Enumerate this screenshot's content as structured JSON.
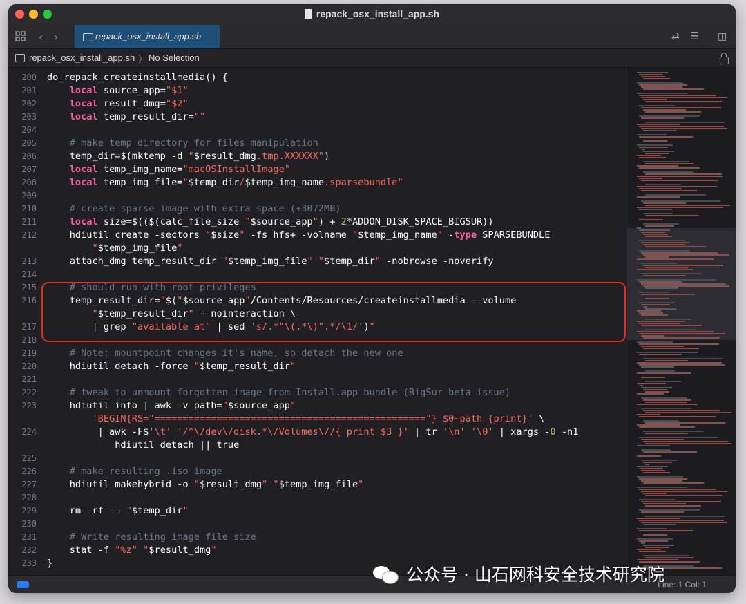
{
  "window": {
    "title": "repack_osx_install_app.sh"
  },
  "tab": {
    "label": "repack_osx_install_app.sh"
  },
  "jumpbar": {
    "file": "repack_osx_install_app.sh",
    "separator": "〉",
    "selection": "No Selection"
  },
  "status": {
    "position": "Line: 1  Col: 1"
  },
  "watermark": {
    "text": "公众号 · 山石网科安全技术研究院"
  },
  "colors": {
    "keyword": "#fc5fa3",
    "string": "#fc6a5d",
    "comment": "#6c7986",
    "number": "#d0bf69",
    "tab_active": "#1f4e79",
    "highlight_box": "#d8302a"
  },
  "icons": [
    "grid-icon",
    "back-chevron-icon",
    "forward-chevron-icon",
    "terminal-file-icon",
    "swap-arrows-icon",
    "lines-icon",
    "sidebar-toggle-icon",
    "lock-icon",
    "wechat-icon"
  ],
  "code_lines": [
    {
      "n": "200",
      "t": [
        [
          "",
          "do_repack_createinstallmedia() {"
        ]
      ]
    },
    {
      "n": "201",
      "t": [
        [
          "",
          "    "
        ],
        [
          "kw",
          "local"
        ],
        [
          "",
          " source_app="
        ],
        [
          "str",
          "\"$1\""
        ]
      ]
    },
    {
      "n": "202",
      "t": [
        [
          "",
          "    "
        ],
        [
          "kw",
          "local"
        ],
        [
          "",
          " result_dmg="
        ],
        [
          "str",
          "\"$2\""
        ]
      ]
    },
    {
      "n": "203",
      "t": [
        [
          "",
          "    "
        ],
        [
          "kw",
          "local"
        ],
        [
          "",
          " temp_result_dir="
        ],
        [
          "str",
          "\"\""
        ]
      ]
    },
    {
      "n": "204",
      "t": []
    },
    {
      "n": "205",
      "t": [
        [
          "",
          "    "
        ],
        [
          "cm",
          "# make temp directory for files manipulation"
        ]
      ]
    },
    {
      "n": "206",
      "t": [
        [
          "",
          "    temp_dir=$(mktemp -d "
        ],
        [
          "str",
          "\""
        ],
        [
          "",
          "$result_dmg"
        ],
        [
          "str",
          ".tmp.XXXXXX\""
        ],
        [
          "",
          ")"
        ]
      ]
    },
    {
      "n": "207",
      "t": [
        [
          "",
          "    "
        ],
        [
          "kw",
          "local"
        ],
        [
          "",
          " temp_img_name="
        ],
        [
          "str",
          "\"macOSInstallImage\""
        ]
      ]
    },
    {
      "n": "208",
      "t": [
        [
          "",
          "    "
        ],
        [
          "kw",
          "local"
        ],
        [
          "",
          " temp_img_file="
        ],
        [
          "str",
          "\""
        ],
        [
          "",
          "$temp_dir"
        ],
        [
          "str",
          "/"
        ],
        [
          "",
          "$temp_img_name"
        ],
        [
          "str",
          ".sparsebundle\""
        ]
      ]
    },
    {
      "n": "209",
      "t": []
    },
    {
      "n": "210",
      "t": [
        [
          "",
          "    "
        ],
        [
          "cm",
          "# create sparse image with extra space (+3072MB)"
        ]
      ]
    },
    {
      "n": "211",
      "t": [
        [
          "",
          "    "
        ],
        [
          "kw",
          "local"
        ],
        [
          "",
          " size=$(($(calc_file_size "
        ],
        [
          "str",
          "\""
        ],
        [
          "",
          "$source_app"
        ],
        [
          "str",
          "\""
        ],
        [
          "",
          ") + "
        ],
        [
          "num",
          "2"
        ],
        [
          "",
          "*ADDON_DISK_SPACE_BIGSUR))"
        ]
      ]
    },
    {
      "n": "212",
      "t": [
        [
          "",
          "    hdiutil create -sectors "
        ],
        [
          "str",
          "\""
        ],
        [
          "",
          "$size"
        ],
        [
          "str",
          "\""
        ],
        [
          "",
          " -fs hfs+ -volname "
        ],
        [
          "str",
          "\""
        ],
        [
          "",
          "$temp_img_name"
        ],
        [
          "str",
          "\""
        ],
        [
          "",
          " -"
        ],
        [
          "kw",
          "type"
        ],
        [
          "",
          " SPARSEBUNDLE"
        ]
      ]
    },
    {
      "n": "",
      "t": [
        [
          "",
          "        "
        ],
        [
          "str",
          "\""
        ],
        [
          "",
          "$temp_img_file"
        ],
        [
          "str",
          "\""
        ]
      ]
    },
    {
      "n": "213",
      "t": [
        [
          "",
          "    attach_dmg temp_result_dir "
        ],
        [
          "str",
          "\""
        ],
        [
          "",
          "$temp_img_file"
        ],
        [
          "str",
          "\""
        ],
        [
          "",
          " "
        ],
        [
          "str",
          "\""
        ],
        [
          "",
          "$temp_dir"
        ],
        [
          "str",
          "\""
        ],
        [
          "",
          " -nobrowse -noverify"
        ]
      ]
    },
    {
      "n": "214",
      "t": []
    },
    {
      "n": "215",
      "t": [
        [
          "",
          "    "
        ],
        [
          "cm",
          "# should run with root privileges"
        ]
      ]
    },
    {
      "n": "216",
      "t": [
        [
          "",
          "    temp_result_dir="
        ],
        [
          "str",
          "\""
        ],
        [
          "",
          "$("
        ],
        [
          "str",
          "\""
        ],
        [
          "",
          "$source_app"
        ],
        [
          "str",
          "\""
        ],
        [
          "",
          "/Contents/Resources/createinstallmedia --volume"
        ]
      ]
    },
    {
      "n": "",
      "t": [
        [
          "",
          "        "
        ],
        [
          "str",
          "\""
        ],
        [
          "",
          "$temp_result_dir"
        ],
        [
          "str",
          "\""
        ],
        [
          "",
          " --nointeraction \\"
        ]
      ]
    },
    {
      "n": "217",
      "t": [
        [
          "",
          "        | grep "
        ],
        [
          "str",
          "\"available at\""
        ],
        [
          "",
          " | sed "
        ],
        [
          "str",
          "'s/.*\"\\(.*\\)\".*/\\1/'"
        ],
        [
          "",
          ")"
        ],
        [
          "str",
          "\""
        ]
      ]
    },
    {
      "n": "218",
      "t": []
    },
    {
      "n": "219",
      "t": [
        [
          "",
          "    "
        ],
        [
          "cm",
          "# Note: mountpoint changes it's name, so detach the new one"
        ]
      ]
    },
    {
      "n": "220",
      "t": [
        [
          "",
          "    hdiutil detach -force "
        ],
        [
          "str",
          "\""
        ],
        [
          "",
          "$temp_result_dir"
        ],
        [
          "str",
          "\""
        ]
      ]
    },
    {
      "n": "221",
      "t": []
    },
    {
      "n": "222",
      "t": [
        [
          "",
          "    "
        ],
        [
          "cm",
          "# tweak to unmount forgotten image from Install.app bundle (BigSur beta issue)"
        ]
      ]
    },
    {
      "n": "223",
      "t": [
        [
          "",
          "    hdiutil info | awk -v path="
        ],
        [
          "str",
          "\""
        ],
        [
          "",
          "$source_app"
        ],
        [
          "str",
          "\""
        ]
      ]
    },
    {
      "n": "",
      "t": [
        [
          "",
          "        "
        ],
        [
          "str",
          "'BEGIN{RS=\"================================================\"} $0~path {print}'"
        ],
        [
          "",
          " \\"
        ]
      ]
    },
    {
      "n": "224",
      "t": [
        [
          "",
          "         | awk -F$"
        ],
        [
          "str",
          "'\\t'"
        ],
        [
          "",
          " "
        ],
        [
          "str",
          "'/^\\/dev\\/disk.*\\/Volumes\\//{ print $3 }'"
        ],
        [
          "",
          " | tr "
        ],
        [
          "str",
          "'\\n'"
        ],
        [
          "",
          " "
        ],
        [
          "str",
          "'\\0'"
        ],
        [
          "",
          " | xargs -"
        ],
        [
          "num",
          "0"
        ],
        [
          "",
          " -n1"
        ]
      ]
    },
    {
      "n": "",
      "t": [
        [
          "",
          "            hdiutil detach || true"
        ]
      ]
    },
    {
      "n": "225",
      "t": []
    },
    {
      "n": "226",
      "t": [
        [
          "",
          "    "
        ],
        [
          "cm",
          "# make resulting .iso image"
        ]
      ]
    },
    {
      "n": "227",
      "t": [
        [
          "",
          "    hdiutil makehybrid -o "
        ],
        [
          "str",
          "\""
        ],
        [
          "",
          "$result_dmg"
        ],
        [
          "str",
          "\""
        ],
        [
          "",
          " "
        ],
        [
          "str",
          "\""
        ],
        [
          "",
          "$temp_img_file"
        ],
        [
          "str",
          "\""
        ]
      ]
    },
    {
      "n": "228",
      "t": []
    },
    {
      "n": "229",
      "t": [
        [
          "",
          "    rm -rf -- "
        ],
        [
          "str",
          "\""
        ],
        [
          "",
          "$temp_dir"
        ],
        [
          "str",
          "\""
        ]
      ]
    },
    {
      "n": "230",
      "t": []
    },
    {
      "n": "231",
      "t": [
        [
          "",
          "    "
        ],
        [
          "cm",
          "# Write resulting image file size"
        ]
      ]
    },
    {
      "n": "232",
      "t": [
        [
          "",
          "    stat -f "
        ],
        [
          "str",
          "\"%z\""
        ],
        [
          "",
          " "
        ],
        [
          "str",
          "\""
        ],
        [
          "",
          "$result_dmg"
        ],
        [
          "str",
          "\""
        ]
      ]
    },
    {
      "n": "233",
      "t": [
        [
          "",
          "}"
        ]
      ]
    }
  ]
}
